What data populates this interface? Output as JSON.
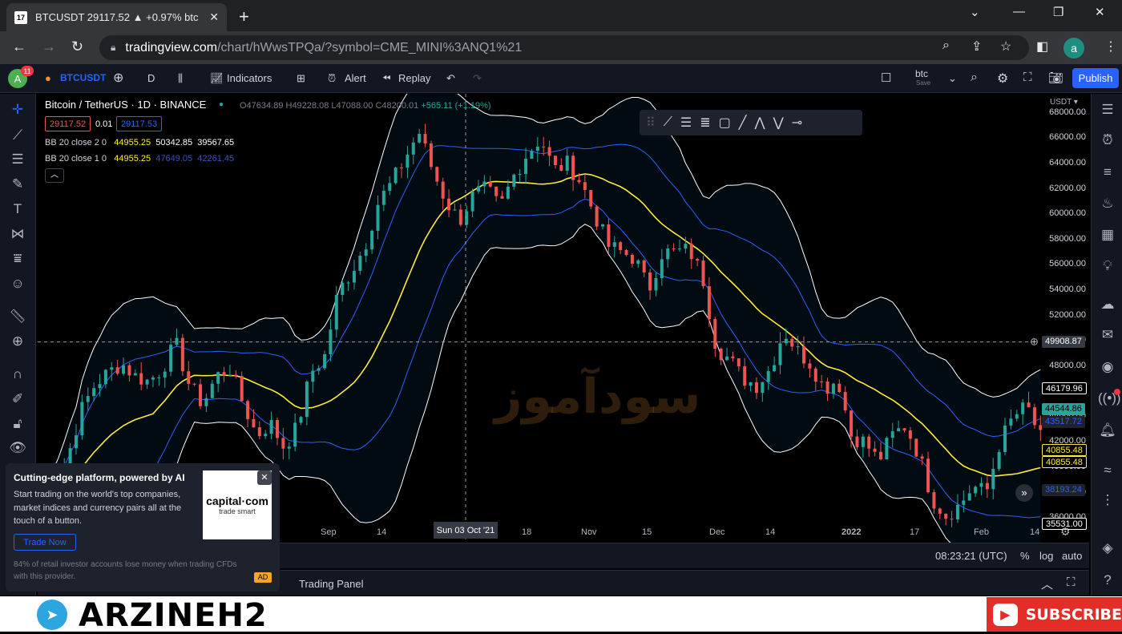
{
  "browser": {
    "tab_title": "BTCUSDT 29117.52 ▲ +0.97% btc",
    "tab_favicon": "tradingview-logo-icon",
    "url_host": "tradingview.com",
    "url_path": "/chart/hWwsTPQa/?symbol=CME_MINI%3ANQ1%21",
    "profile_initial": "a"
  },
  "toolbar": {
    "avatar_initial": "A",
    "notifications": "11",
    "symbol": "BTCUSDT",
    "interval": "D",
    "indicators_label": "Indicators",
    "alert_label": "Alert",
    "replay_label": "Replay",
    "layout_name": "btc",
    "layout_status": "Save",
    "publish_label": "Publish"
  },
  "chart_header": {
    "title": "Bitcoin / TetherUS · 1D · BINANCE",
    "open": "O47634.89",
    "high": "H49228.08",
    "low": "L47088.00",
    "close": "C48200.01",
    "change": "+565.11 (+1.19%)",
    "sell_price": "29117.52",
    "spread": "0.01",
    "buy_price": "29117.53",
    "currency": "USDT ▾"
  },
  "indicators": [
    {
      "name": "BB 20 close 2 0",
      "basis": "44955.25",
      "upper": "50342.85",
      "lower": "39567.65"
    },
    {
      "name": "BB 20 close 1 0",
      "basis": "44955.25",
      "upper": "47649.05",
      "lower": "42261.45"
    }
  ],
  "price_axis": [
    "68000.00",
    "66000.00",
    "64000.00",
    "62000.00",
    "60000.00",
    "58000.00",
    "56000.00",
    "54000.00",
    "52000.00",
    "50000.00",
    "48000.00",
    "46000.00",
    "44000.00",
    "42000.00",
    "40000.00",
    "38000.00",
    "36000.00"
  ],
  "price_tags": {
    "crosshair": "49908.87",
    "bb_upper": "46179.96",
    "last_green": "44544.86",
    "bb_inner_upper": "43517.72",
    "basis_1": "40855.48",
    "basis_2": "40855.48",
    "bb_inner_lower": "38193.24",
    "bb_lower": "35531.00"
  },
  "time_axis": [
    "Sep",
    "14",
    "18",
    "Nov",
    "15",
    "Dec",
    "14",
    "2022",
    "17",
    "Feb",
    "14"
  ],
  "crosshair_date": "Sun 03 Oct '21",
  "bottom": {
    "clock": "08:23:21 (UTC)",
    "percent": "%",
    "log": "log",
    "auto": "auto"
  },
  "trading_panel": "Trading Panel",
  "ad": {
    "headline": "Cutting-edge platform, powered by AI",
    "body": "Start trading on the world's top companies, market indices and currency pairs all at the touch of a button.",
    "button": "Trade Now",
    "disclaimer": "84% of retail investor accounts lose money when trading CFDs with this provider.",
    "logo_main": "capital·com",
    "logo_sub": "trade smart",
    "tag": "AD"
  },
  "watermark": "سودآموز",
  "footer": {
    "brand": "ARZINEH2",
    "subscribe": "SUBSCRIBE"
  },
  "colors": {
    "up": "#26a69a",
    "down": "#ef5350",
    "basis": "#ffeb3b",
    "outer_band": "#ffffff",
    "inner_band": "#2962ff",
    "publish": "#2962ff"
  },
  "chart_data": {
    "type": "candlestick",
    "symbol": "BTCUSDT",
    "interval": "1D",
    "ylim": [
      35000,
      68500
    ],
    "overlays": [
      "Bollinger Bands 20 close 2",
      "Bollinger Bands 20 close 1"
    ],
    "close_path": [
      36500,
      38500,
      40800,
      44500,
      46500,
      47500,
      48200,
      47200,
      46800,
      47800,
      49800,
      46500,
      45000,
      47200,
      47800,
      45000,
      42500,
      43500,
      41600,
      43200,
      47500,
      48700,
      53800,
      55500,
      57500,
      61000,
      62500,
      64500,
      66500,
      63500,
      61000,
      59500,
      61500,
      62000,
      60500,
      63000,
      64800,
      66000,
      63500,
      64000,
      62500,
      60000,
      57500,
      57000,
      56500,
      54000,
      57000,
      57000,
      57200,
      55000,
      49500,
      48500,
      47000,
      46500,
      47800,
      50800,
      49200,
      48200,
      46200,
      47000,
      42500,
      42000,
      40500,
      42500,
      43300,
      41000,
      37500,
      36200,
      37000,
      38500,
      38000,
      42000,
      44000,
      44800,
      42300
    ]
  }
}
